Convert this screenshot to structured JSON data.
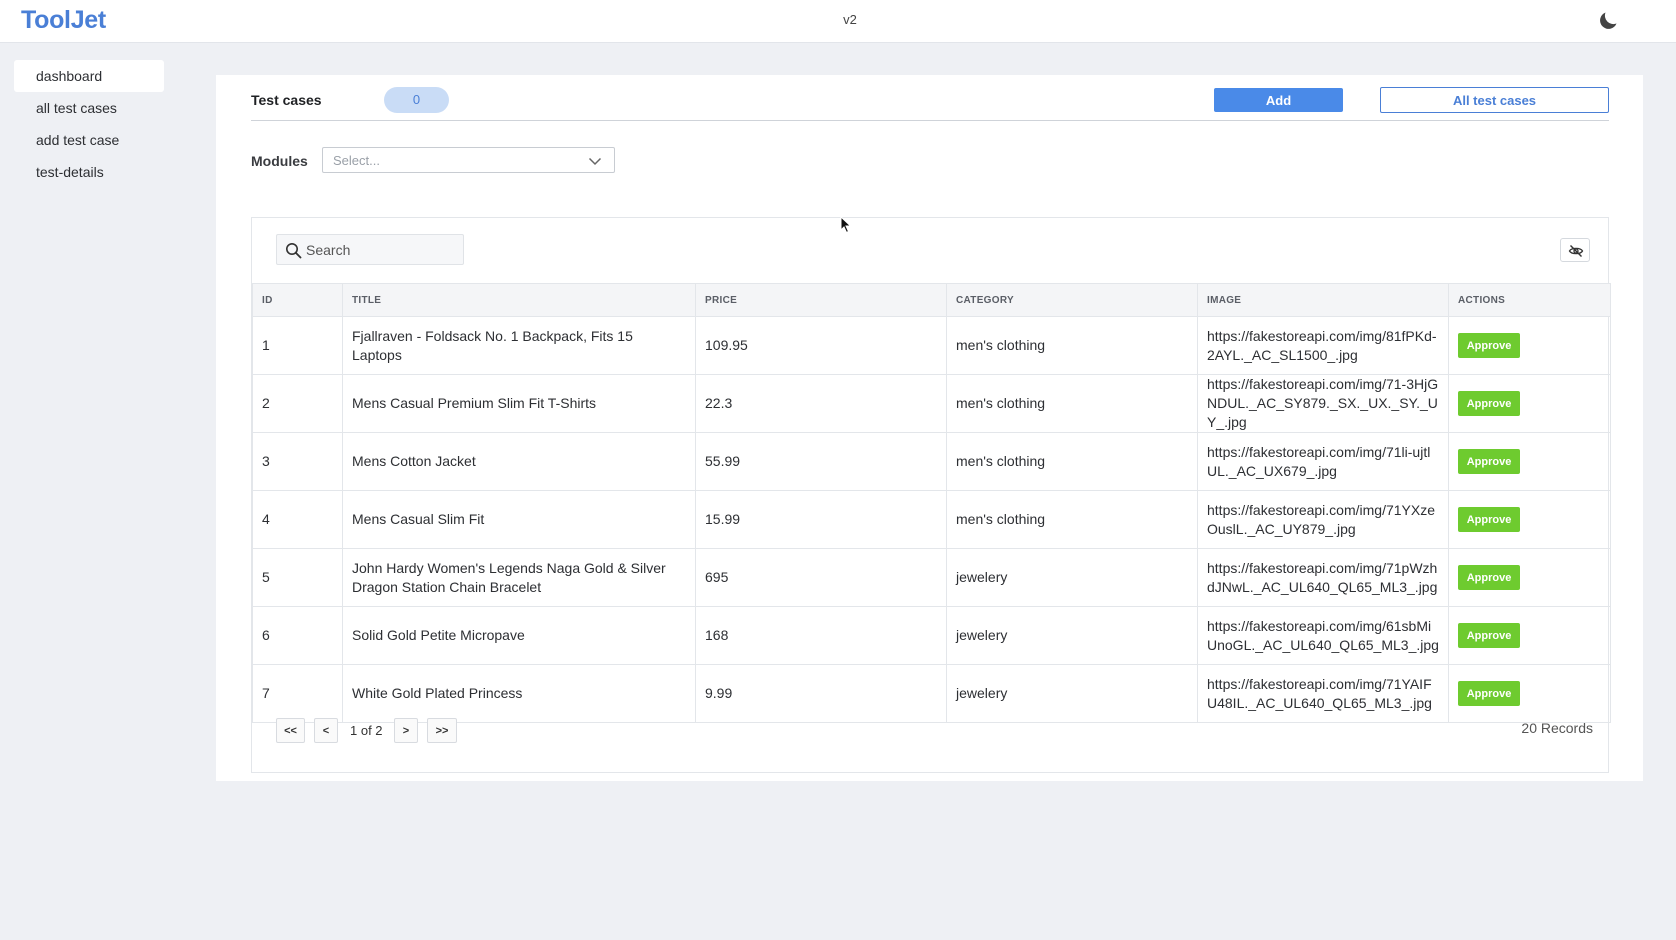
{
  "app": {
    "logo": "ToolJet",
    "version": "v2"
  },
  "sidebar": {
    "items": [
      {
        "label": "dashboard"
      },
      {
        "label": "all test cases"
      },
      {
        "label": "add test case"
      },
      {
        "label": "test-details"
      }
    ]
  },
  "header": {
    "title": "Test cases",
    "count": "0",
    "add_label": "Add",
    "all_label": "All test cases"
  },
  "filters": {
    "modules_label": "Modules",
    "modules_placeholder": "Select..."
  },
  "table": {
    "search_placeholder": "Search",
    "columns": {
      "id": "ID",
      "title": "TITLE",
      "price": "PRICE",
      "category": "CATEGORY",
      "image": "IMAGE",
      "actions": "ACTIONS"
    },
    "action_label": "Approve",
    "rows": [
      {
        "id": "1",
        "title": "Fjallraven - Foldsack No. 1 Backpack, Fits 15 Laptops",
        "price": "109.95",
        "category": "men's clothing",
        "image": "https://fakestoreapi.com/img/81fPKd-2AYL._AC_SL1500_.jpg"
      },
      {
        "id": "2",
        "title": "Mens Casual Premium Slim Fit T-Shirts",
        "price": "22.3",
        "category": "men's clothing",
        "image": "https://fakestoreapi.com/img/71-3HjGNDUL._AC_SY879._SX._UX._SY._UY_.jpg"
      },
      {
        "id": "3",
        "title": "Mens Cotton Jacket",
        "price": "55.99",
        "category": "men's clothing",
        "image": "https://fakestoreapi.com/img/71li-ujtlUL._AC_UX679_.jpg"
      },
      {
        "id": "4",
        "title": "Mens Casual Slim Fit",
        "price": "15.99",
        "category": "men's clothing",
        "image": "https://fakestoreapi.com/img/71YXzeOuslL._AC_UY879_.jpg"
      },
      {
        "id": "5",
        "title": "John Hardy Women's Legends Naga Gold & Silver Dragon Station Chain Bracelet",
        "price": "695",
        "category": "jewelery",
        "image": "https://fakestoreapi.com/img/71pWzhdJNwL._AC_UL640_QL65_ML3_.jpg"
      },
      {
        "id": "6",
        "title": "Solid Gold Petite Micropave",
        "price": "168",
        "category": "jewelery",
        "image": "https://fakestoreapi.com/img/61sbMiUnoGL._AC_UL640_QL65_ML3_.jpg"
      },
      {
        "id": "7",
        "title": "White Gold Plated Princess",
        "price": "9.99",
        "category": "jewelery",
        "image": "https://fakestoreapi.com/img/71YAIFU48IL._AC_UL640_QL65_ML3_.jpg"
      }
    ]
  },
  "pagination": {
    "first": "<<",
    "prev": "<",
    "page_text": "1 of 2",
    "next": ">",
    "last": ">>",
    "records": "20 Records"
  },
  "icons": {
    "theme": "moon-icon",
    "search": "search-icon",
    "column_visibility": "eye-off-icon",
    "select_arrow": "chevron-down-icon"
  },
  "colors": {
    "brand": "#4a7fd6",
    "primary_button": "#4a8ae8",
    "approve": "#6ecb2f",
    "badge_bg": "#c9dcf6"
  }
}
